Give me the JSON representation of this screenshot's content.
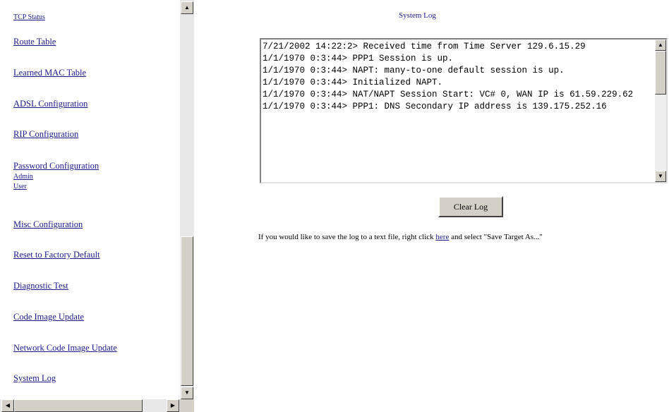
{
  "nav": {
    "items": [
      {
        "label": "TCP Status"
      },
      {
        "label": "Route Table"
      },
      {
        "label": "Learned MAC Table"
      },
      {
        "label": "ADSL Configuration"
      },
      {
        "label": "RIP Configuration"
      },
      {
        "label": "Password Configuration"
      },
      {
        "label": "Admin"
      },
      {
        "label": "User"
      },
      {
        "label": "Misc Configuration"
      },
      {
        "label": "Reset to Factory Default"
      },
      {
        "label": "Diagnostic Test"
      },
      {
        "label": "Code Image Update"
      },
      {
        "label": "Network Code Image Update"
      },
      {
        "label": "System Log"
      }
    ]
  },
  "main": {
    "title": "System Log",
    "log_text": "7/21/2002 14:22:2> Received time from Time Server 129.6.15.29\n1/1/1970 0:3:44> PPP1 Session is up.\n1/1/1970 0:3:44> NAPT: many-to-one default session is up.\n1/1/1970 0:3:44> Initialized NAPT.\n1/1/1970 0:3:44> NAT/NAPT Session Start: VC# 0, WAN IP is 61.59.229.62\n1/1/1970 0:3:44> PPP1: DNS Secondary IP address is 139.175.252.16",
    "clear_button_label": "Clear Log",
    "save_text_before": "If you would like to save the log to a text file, right click ",
    "save_link_label": "here",
    "save_text_after": " and select \"Save Target As...\""
  },
  "scroll_glyphs": {
    "up": "▲",
    "down": "▼",
    "left": "◀",
    "right": "▶"
  }
}
